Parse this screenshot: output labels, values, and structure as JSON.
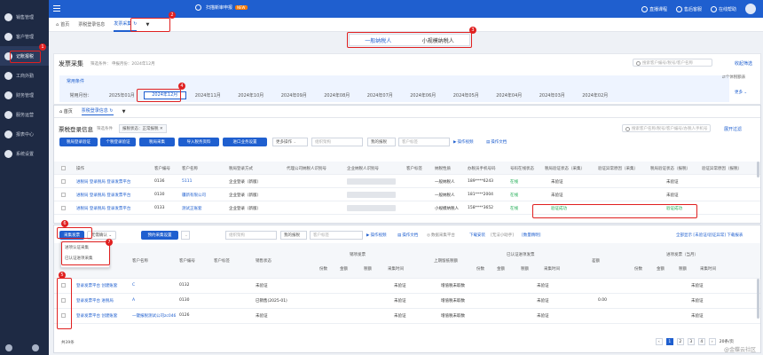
{
  "sidebar": {
    "items": [
      {
        "label": "销售管理",
        "icon": "sales-icon"
      },
      {
        "label": "客户管理",
        "icon": "customer-icon"
      },
      {
        "label": "记账报税",
        "icon": "tax-icon",
        "active": true
      },
      {
        "label": "工商外勤",
        "icon": "field-icon"
      },
      {
        "label": "财务管理",
        "icon": "finance-icon"
      },
      {
        "label": "服务运营",
        "icon": "service-icon"
      },
      {
        "label": "报表中心",
        "icon": "report-icon"
      },
      {
        "label": "系统设置",
        "icon": "settings-icon"
      }
    ]
  },
  "topbar": {
    "promo": "扫描新审申报",
    "new_badge": "NEW",
    "links": [
      "直播课程",
      "售后客服",
      "在线帮助"
    ]
  },
  "tabs": [
    {
      "label": "首页"
    },
    {
      "label": "票税登录信息"
    },
    {
      "label": "发票采集",
      "active": true
    }
  ],
  "taxpayer_switch": {
    "general": "一般纳税人",
    "small": "小规模纳税人"
  },
  "invoice_collect": {
    "title": "发票采集",
    "filter_hint": "筛选条件：",
    "filter_period": "申报月份：2024年12月",
    "search_placeholder": "搜索客户编号/税号/客户名称",
    "fold": "收起筛选",
    "category_label": "常用条件",
    "period_label": "常用月份：",
    "months": [
      "2025年01月",
      "2024年12月",
      "2024年11月",
      "2024年10月",
      "2024年09月",
      "2024年08月",
      "2024年07月",
      "2024年06月",
      "2024年05月",
      "2024年04月",
      "2024年03月",
      "2024年02月"
    ],
    "selected_month": "2024年12月",
    "more": "更多 ⌄",
    "side_note": "⇄个体税额表"
  },
  "login_info": {
    "tabs": [
      "首页",
      "票税登录信息"
    ],
    "title": "票税登录信息",
    "filter_hint": "筛选条件",
    "filter_tag": "报税状态：正常报税 ✕",
    "search_placeholder": "搜索客户名称/税号/客户编号/办税人手机号",
    "fold": "展开过滤",
    "buttons": [
      "税局登录验证",
      "个税登录验证",
      "税局采集",
      "导入税务资料",
      "进口业务设置"
    ],
    "more_ops": "更多操作",
    "org_placeholder": "组织架构",
    "my_clients": "我的报税",
    "client_tag_placeholder": "客户标签",
    "video_link": "操作视频",
    "doc_link": "操作文档",
    "columns": [
      "操作",
      "客户编号",
      "客户名称",
      "税局登录方式",
      "代理公司纳税人识别号",
      "企业纳税人识别号",
      "客户标签",
      "纳税性质",
      "办税员手机号码",
      "号码在线状态",
      "税局验证状态（采集）",
      "验证异常原因（采集）",
      "税局验证状态（报税）",
      "验证异常原因（报税）"
    ],
    "rows": [
      {
        "op": "进税局 登录税局 登录发票平台",
        "code": "0136",
        "name": "5111",
        "login": "企业登录（新版）",
        "nature": "一般纳税人",
        "phone": "189****6243",
        "online": "在线",
        "verify_collect": "未验证",
        "reason_collect": "",
        "verify_tax": "未验证"
      },
      {
        "op": "进税局 登录税局 登录发票平台",
        "code": "0130",
        "name": "疆新有限公司",
        "login": "企业登录（新版）",
        "nature": "一般纳税人",
        "phone": "181****2004",
        "online": "在线",
        "verify_collect": "未验证",
        "reason_collect": "",
        "verify_tax": "未验证"
      },
      {
        "op": "进税局 登录税局 登录发票平台",
        "code": "0133",
        "name": "测试正账套",
        "login": "企业登录（新版）",
        "nature": "小规模纳税人",
        "phone": "158****3652",
        "online": "在线",
        "verify_collect": "验证成功",
        "reason_collect": "",
        "verify_tax": "验证成功"
      }
    ]
  },
  "collect_table": {
    "buttons": [
      "采集发票",
      "无需确认",
      "预约采集设置"
    ],
    "org_placeholder": "组织架构",
    "my_clients": "我的报税",
    "client_tag_placeholder": "客户标签",
    "links": [
      "操作视频",
      "操作文档",
      "数据采集平台",
      "下载安装",
      "[无法小助手]",
      "[数量精明]"
    ],
    "right_links": "全部显示 [未验证/验证异常] 下载报表",
    "popup_items": [
      "进项认证采集",
      "已认证进项采集"
    ],
    "columns": [
      "操作",
      "客户名称",
      "客户编号",
      "客户标签",
      "销售状态",
      "销项发票",
      "上期留抵税额",
      "已认证进项发票",
      "差额",
      "进项发票（当月）"
    ],
    "sub_columns": [
      "份数",
      "金额",
      "税额",
      "采集时间"
    ],
    "rows": [
      {
        "op": "登录发票平台 创建账套",
        "name": "C",
        "code": "0132",
        "status": "未验证",
        "collect": "未验证",
        "tax": "增值税未取数",
        "verify": "未验证",
        "diff": ""
      },
      {
        "op": "登录发票平台 进税局",
        "name": "A",
        "code": "0130",
        "status": "已销售(2025-01)",
        "collect": "未验证",
        "tax": "增值税未取数",
        "verify": "未验证",
        "diff": "0.00"
      },
      {
        "op": "登录发票平台 创建账套",
        "name": "一键报税测试公司zc046",
        "code": "0126",
        "status": "未验证",
        "collect": "未验证",
        "tax": "增值税未取数",
        "verify": "未验证",
        "diff": ""
      }
    ],
    "total": "共39条",
    "pages": [
      "1",
      "2",
      "3",
      "4"
    ],
    "page_size": "20条/页"
  },
  "annotations": [
    "1",
    "2",
    "3",
    "4",
    "5",
    "6",
    "7"
  ],
  "watermark": "@金蝶云社区"
}
